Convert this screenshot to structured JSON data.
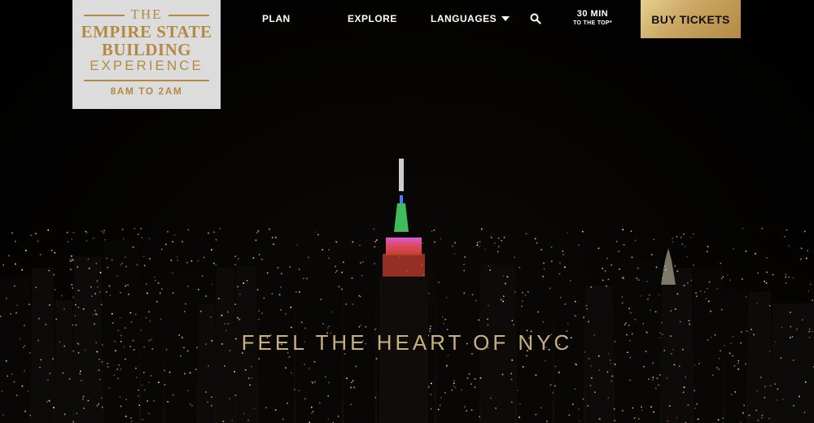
{
  "logo": {
    "the": "THE",
    "line1": "EMPIRE STATE",
    "line2": "BUILDING",
    "experience": "EXPERIENCE",
    "hours": "8AM TO 2AM",
    "gold": "#b38a44"
  },
  "nav": {
    "plan": "PLAN",
    "explore": "EXPLORE",
    "languages": "LANGUAGES",
    "search_icon": "search-icon",
    "wait_time": "30 MIN",
    "wait_caption": "TO THE TOP*",
    "buy": "BUY TICKETS"
  },
  "hero": {
    "headline": "FEEL THE HEART OF NYC"
  },
  "colors": {
    "button_gold": "#c9a561",
    "headline_gold": "#c7b07e"
  }
}
